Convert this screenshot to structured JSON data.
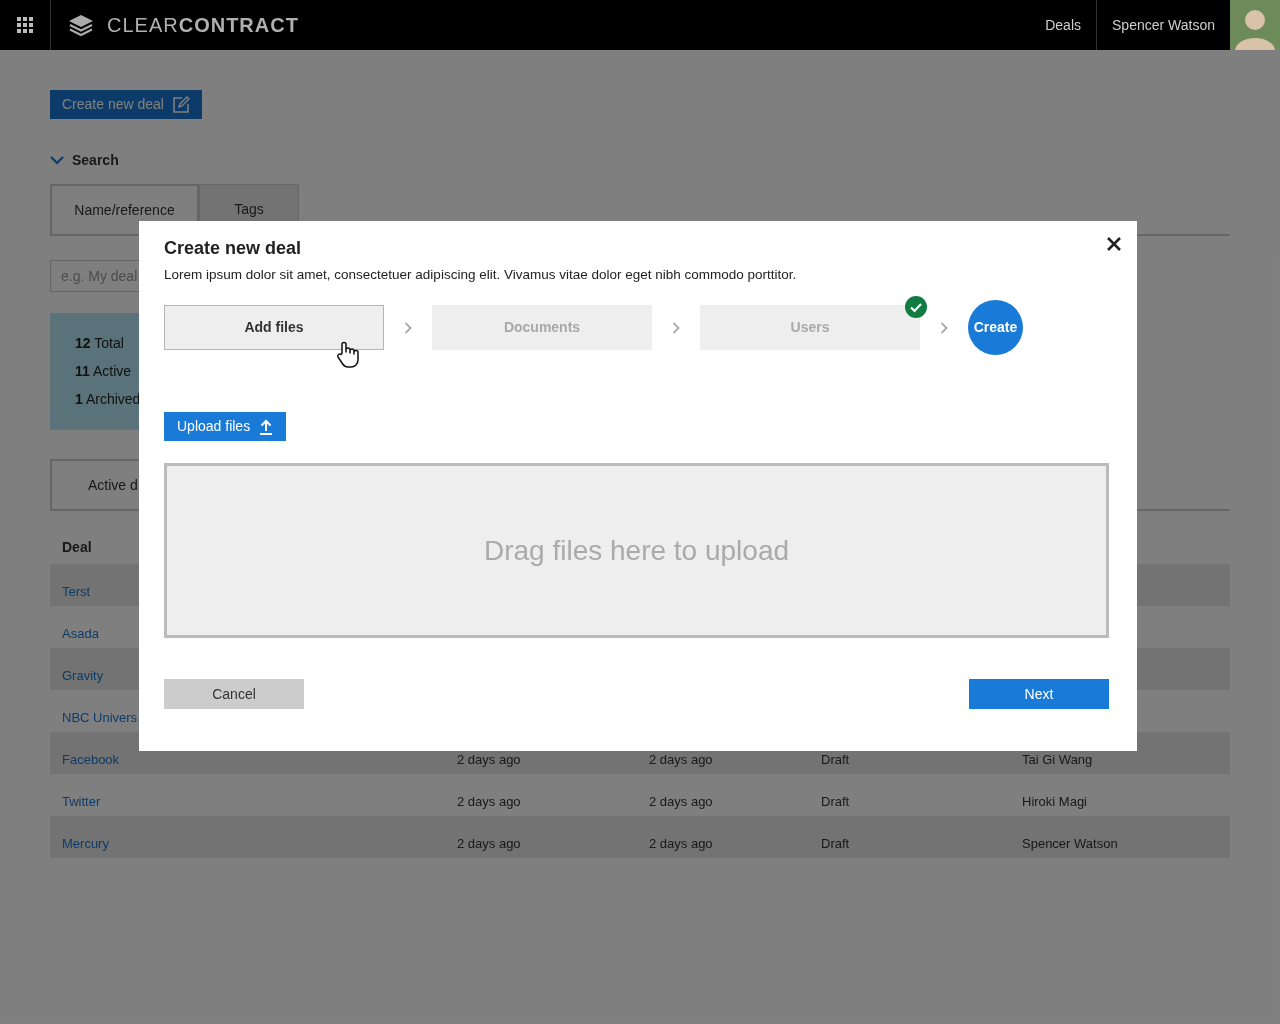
{
  "header": {
    "logo_light": "CLEAR",
    "logo_bold": "CONTRACT",
    "nav": [
      "Deals"
    ],
    "user": "Spencer Watson"
  },
  "create_button": "Create new deal",
  "search": {
    "title": "Search",
    "expanded": true,
    "tabs": [
      {
        "label": "Name/reference",
        "selected": true
      },
      {
        "label": "Tags",
        "selected": false
      }
    ],
    "placeholder": "e.g. My deal"
  },
  "stats": [
    "**12** Total",
    "**11** Active",
    "**1** Archived"
  ],
  "deal_tabs": [
    {
      "label": "Active d",
      "selected": true
    }
  ],
  "table": {
    "columns": [
      "Deal"
    ],
    "rows": [
      {
        "deal": "Terst"
      },
      {
        "deal": "Asada"
      },
      {
        "deal": "Gravity"
      },
      {
        "deal": "NBC Univers"
      },
      {
        "deal": "Facebook",
        "column_2": "2 days ago",
        "column_3": "2 days ago",
        "column_4": "Draft",
        "column_5": "Tai Gi Wang"
      },
      {
        "deal": "Twitter",
        "column_2": "2 days ago",
        "column_3": "2 days ago",
        "column_4": "Draft",
        "column_5": "Hiroki Magi"
      },
      {
        "deal": "Mercury",
        "column_2": "2 days ago",
        "column_3": "2 days ago",
        "column_4": "Draft",
        "column_5": "Spencer Watson"
      }
    ]
  },
  "dialog": {
    "title": "Create new deal",
    "description": "Lorem ipsum dolor sit amet, consectetuer adipiscing elit. Vivamus vitae dolor eget nibh commodo porttitor.",
    "steps": [
      {
        "kind": "step",
        "label": "Add files",
        "selected": true,
        "completed": false
      },
      {
        "kind": "step",
        "label": "Documents",
        "selected": false,
        "completed": false
      },
      {
        "kind": "step",
        "label": "Users",
        "selected": false,
        "completed": true
      },
      {
        "kind": "final",
        "label": "Create"
      }
    ],
    "upload_button": "Upload files",
    "dropzone": "Drag files here to upload",
    "cancel": "Cancel",
    "next": "Next"
  }
}
